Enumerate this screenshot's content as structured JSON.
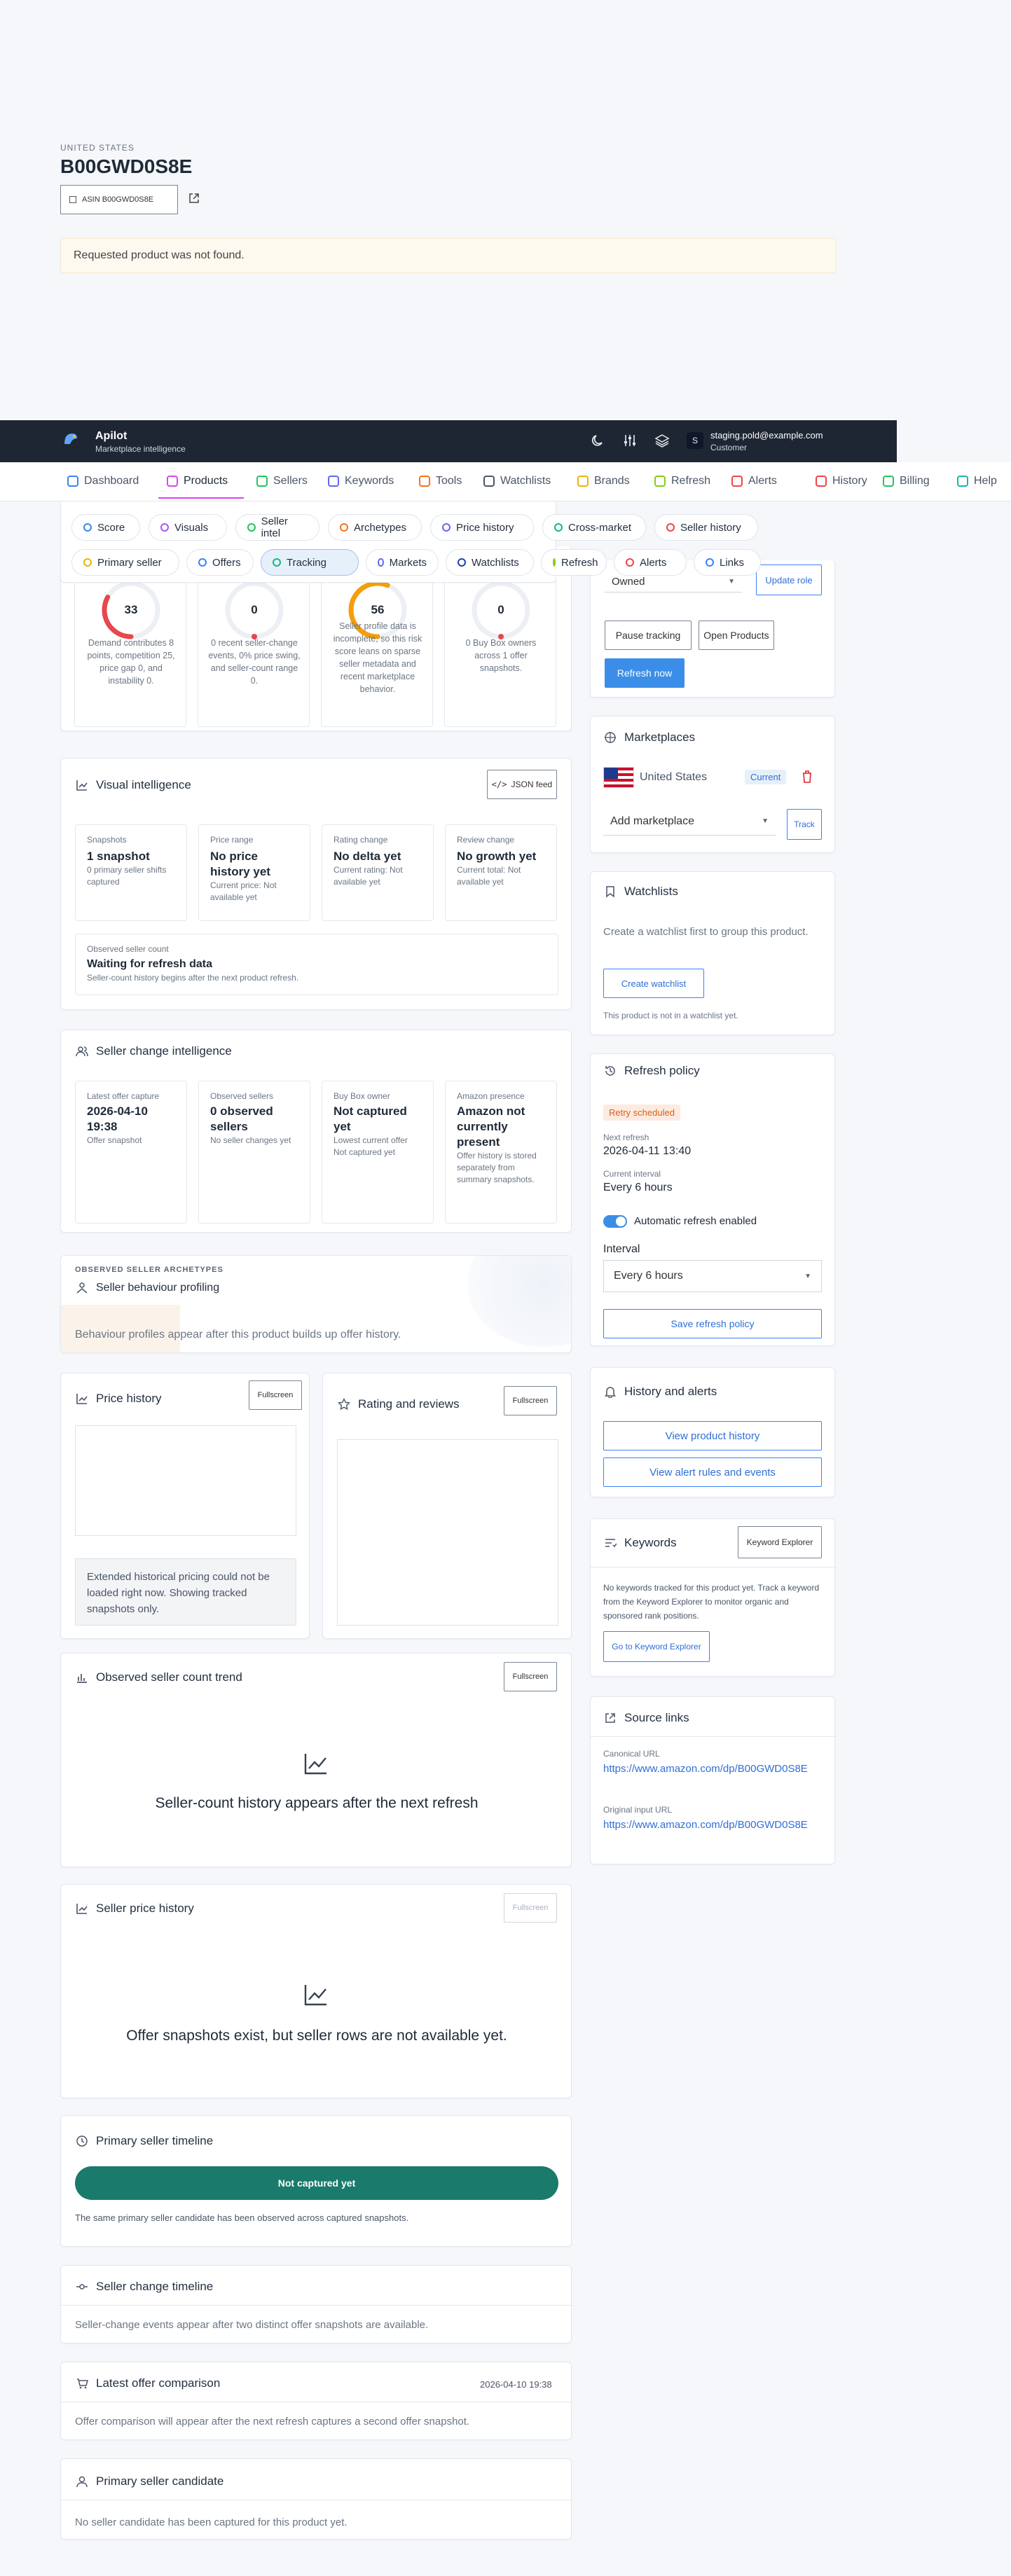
{
  "top": {
    "country": "UNITED STATES",
    "asin_title": "B00GWD0S8E",
    "asin_chip": "ASIN B00GWD0S8E",
    "not_found": "Requested product was not found."
  },
  "app": {
    "name": "Apilot",
    "subtitle": "Marketplace intelligence",
    "user_email": "staging.pold@example.com",
    "user_role": "Customer",
    "avatar_letter": "S"
  },
  "nav": [
    {
      "label": "Dashboard",
      "color": "#3b82f6"
    },
    {
      "label": "Products",
      "color": "#d946ef"
    },
    {
      "label": "Sellers",
      "color": "#22c55e"
    },
    {
      "label": "Keywords",
      "color": "#6366f1"
    },
    {
      "label": "Tools",
      "color": "#f97316"
    },
    {
      "label": "Watchlists",
      "color": "#4b5563"
    },
    {
      "label": "Brands",
      "color": "#eab308"
    },
    {
      "label": "Refresh",
      "color": "#84cc16"
    },
    {
      "label": "Alerts",
      "color": "#ef4444"
    },
    {
      "label": "History",
      "color": "#ef4444"
    },
    {
      "label": "Billing",
      "color": "#22c55e"
    },
    {
      "label": "Help",
      "color": "#14b8a6"
    }
  ],
  "subnav_row1": [
    {
      "label": "Score",
      "color": "#3b82f6"
    },
    {
      "label": "Visuals",
      "color": "#a855f7"
    },
    {
      "label": "Seller intel",
      "color": "#22c55e"
    },
    {
      "label": "Archetypes",
      "color": "#f97316"
    },
    {
      "label": "Price history",
      "color": "#6366f1"
    },
    {
      "label": "Cross-market",
      "color": "#10b981"
    },
    {
      "label": "Seller history",
      "color": "#ef4444"
    }
  ],
  "subnav_row2": [
    {
      "label": "Primary seller",
      "color": "#eab308"
    },
    {
      "label": "Offers",
      "color": "#3b82f6"
    },
    {
      "label": "Tracking",
      "color": "#10b981"
    },
    {
      "label": "Markets",
      "color": "#6366f1"
    },
    {
      "label": "Watchlists",
      "color": "#1e40af"
    },
    {
      "label": "Refresh",
      "color": "#84cc16"
    },
    {
      "label": "Alerts",
      "color": "#ef4444"
    },
    {
      "label": "Links",
      "color": "#3b82f6"
    }
  ],
  "gauges": [
    {
      "value": "33",
      "text": "Demand contributes 8 points, competition 25, price gap 0, and instability 0.",
      "color": "#e5484d",
      "pct": 0.33
    },
    {
      "value": "0",
      "text": "0 recent seller-change events, 0% price swing, and seller-count range 0.",
      "color": "#e5484d",
      "pct": 0
    },
    {
      "value": "56",
      "text": "Seller profile data is incomplete, so this risk score leans on sparse seller metadata and recent marketplace behavior.",
      "color": "#f59e0b",
      "pct": 0.56
    },
    {
      "value": "0",
      "text": "0 Buy Box owners across 1 offer snapshots.",
      "color": "#e5484d",
      "pct": 0
    }
  ],
  "visual": {
    "title": "Visual intelligence",
    "json_btn": "JSON feed",
    "tiles": [
      {
        "label": "Snapshots",
        "value": "1 snapshot",
        "sub": "0 primary seller shifts captured"
      },
      {
        "label": "Price range",
        "value": "No price history yet",
        "sub": "Current price: Not available yet"
      },
      {
        "label": "Rating change",
        "value": "No delta yet",
        "sub": "Current rating: Not available yet"
      },
      {
        "label": "Review change",
        "value": "No growth yet",
        "sub": "Current total: Not available yet"
      }
    ],
    "observed_label": "Observed seller count",
    "observed_value": "Waiting for refresh data",
    "observed_sub": "Seller-count history begins after the next product refresh."
  },
  "seller_change": {
    "title": "Seller change intelligence",
    "tiles": [
      {
        "label": "Latest offer capture",
        "value": "2026-04-10 19:38",
        "sub": "Offer snapshot"
      },
      {
        "label": "Observed sellers",
        "value": "0 observed sellers",
        "sub": "No seller changes yet"
      },
      {
        "label": "Buy Box owner",
        "value": "Not captured yet",
        "sub": "Lowest current offer Not captured yet"
      },
      {
        "label": "Amazon presence",
        "value": "Amazon not currently present",
        "sub": "Offer history is stored separately from summary snapshots."
      }
    ]
  },
  "archetypes": {
    "eyebrow": "OBSERVED SELLER ARCHETYPES",
    "title": "Seller behaviour profiling",
    "text": "Behaviour profiles appear after this product builds up offer history."
  },
  "price_history": {
    "title": "Price history",
    "btn": "Fullscreen",
    "note": "Extended historical pricing could not be loaded right now. Showing tracked snapshots only."
  },
  "rating": {
    "title": "Rating and reviews",
    "btn": "Fullscreen"
  },
  "seller_count": {
    "title": "Observed seller count trend",
    "btn": "Fullscreen",
    "empty": "Seller-count history appears after the next refresh"
  },
  "seller_price": {
    "title": "Seller price history",
    "btn": "Fullscreen",
    "empty": "Offer snapshots exist, but seller rows are not available yet."
  },
  "primary_timeline": {
    "title": "Primary seller timeline",
    "bar": "Not captured yet",
    "note": "The same primary seller candidate has been observed across captured snapshots."
  },
  "change_timeline": {
    "title": "Seller change timeline",
    "text": "Seller-change events appear after two distinct offer snapshots are available."
  },
  "latest_offer": {
    "title": "Latest offer comparison",
    "date": "2026-04-10 19:38",
    "text": "Offer comparison will appear after the next refresh captures a second offer snapshot."
  },
  "candidate": {
    "title": "Primary seller candidate",
    "text": "No seller candidate has been captured for this product yet."
  },
  "tracking": {
    "role_select": "Owned",
    "update_role": "Update role",
    "pause": "Pause tracking",
    "open_products": "Open Products",
    "refresh_now": "Refresh now"
  },
  "marketplaces": {
    "title": "Marketplaces",
    "market": "United States",
    "current": "Current",
    "add_placeholder": "Add marketplace",
    "track": "Track"
  },
  "watchlists": {
    "title": "Watchlists",
    "text": "Create a watchlist first to group this product.",
    "btn": "Create watchlist",
    "note": "This product is not in a watchlist yet."
  },
  "refresh_policy": {
    "title": "Refresh policy",
    "badge": "Retry scheduled",
    "next_label": "Next refresh",
    "next_value": "2026-04-11 13:40",
    "interval_label": "Current interval",
    "interval_value": "Every 6 hours",
    "auto": "Automatic refresh enabled",
    "interval_title": "Interval",
    "interval_select": "Every 6 hours",
    "save": "Save refresh policy"
  },
  "history_alerts": {
    "title": "History and alerts",
    "btn1": "View product history",
    "btn2": "View alert rules and events"
  },
  "keywords": {
    "title": "Keywords",
    "btn": "Keyword Explorer",
    "text": "No keywords tracked for this product yet. Track a keyword from the Keyword Explorer to monitor organic and sponsored rank positions.",
    "go": "Go to Keyword Explorer"
  },
  "source_links": {
    "title": "Source links",
    "canonical_label": "Canonical URL",
    "canonical": "https://www.amazon.com/dp/B00GWD0S8E",
    "original_label": "Original input URL",
    "original": "https://www.amazon.com/dp/B00GWD0S8E"
  }
}
